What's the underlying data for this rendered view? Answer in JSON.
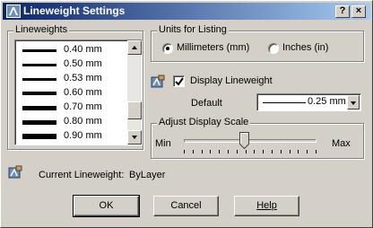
{
  "window": {
    "title": "Lineweight Settings",
    "help_glyph": "?",
    "close_glyph": "×"
  },
  "lineweights": {
    "group_label": "Lineweights",
    "items": [
      {
        "label": "0.40 mm",
        "weight_mm": 0.4
      },
      {
        "label": "0.50 mm",
        "weight_mm": 0.5
      },
      {
        "label": "0.53 mm",
        "weight_mm": 0.53
      },
      {
        "label": "0.60 mm",
        "weight_mm": 0.6
      },
      {
        "label": "0.70 mm",
        "weight_mm": 0.7
      },
      {
        "label": "0.80 mm",
        "weight_mm": 0.8
      },
      {
        "label": "0.90 mm",
        "weight_mm": 0.9
      }
    ]
  },
  "units": {
    "group_label": "Units for Listing",
    "options": [
      {
        "label": "Millimeters (mm)",
        "selected": true
      },
      {
        "label": "Inches (in)",
        "selected": false
      }
    ]
  },
  "display_lineweight": {
    "label": "Display Lineweight",
    "checked": true
  },
  "default": {
    "label": "Default",
    "value": "0.25 mm"
  },
  "scale": {
    "group_label": "Adjust Display Scale",
    "min_label": "Min",
    "max_label": "Max",
    "position": 0.45
  },
  "current": {
    "label": "Current Lineweight:",
    "value": "ByLayer"
  },
  "buttons": {
    "ok": "OK",
    "cancel": "Cancel",
    "help": "Help"
  }
}
